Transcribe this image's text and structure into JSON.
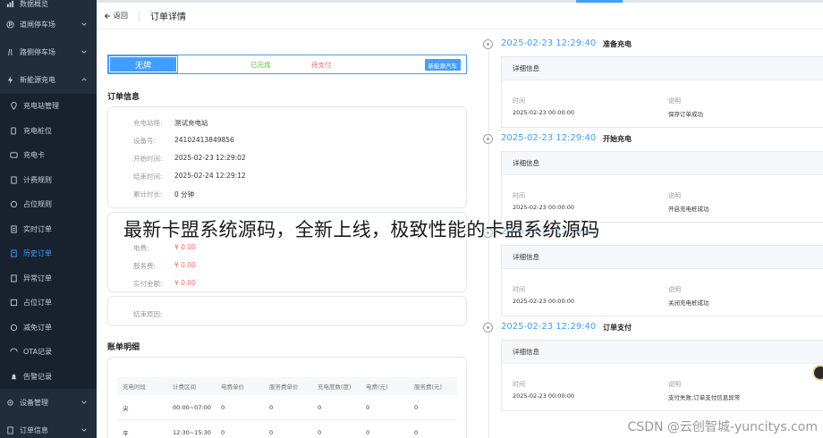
{
  "sidebar": {
    "items": [
      {
        "label": "数据概览",
        "icon": "chart-icon",
        "type": "top"
      },
      {
        "label": "道闸停车场",
        "icon": "parking-icon",
        "type": "group"
      },
      {
        "label": "路侧停车场",
        "icon": "road-icon",
        "type": "group"
      },
      {
        "label": "新能源充电",
        "icon": "charging-icon",
        "type": "group-open"
      },
      {
        "label": "充电站管理",
        "icon": "location-icon",
        "type": "sub"
      },
      {
        "label": "充电桩位",
        "icon": "pile-icon",
        "type": "sub"
      },
      {
        "label": "充电卡",
        "icon": "card-icon",
        "type": "sub"
      },
      {
        "label": "计费规则",
        "icon": "doc-icon",
        "type": "sub"
      },
      {
        "label": "占位规则",
        "icon": "rule-icon",
        "type": "sub"
      },
      {
        "label": "实时订单",
        "icon": "order-icon",
        "type": "sub"
      },
      {
        "label": "历史订单",
        "icon": "history-icon",
        "type": "sub-active"
      },
      {
        "label": "异常订单",
        "icon": "warning-order-icon",
        "type": "sub"
      },
      {
        "label": "占位订单",
        "icon": "occupy-icon",
        "type": "sub"
      },
      {
        "label": "减免订单",
        "icon": "discount-icon",
        "type": "sub"
      },
      {
        "label": "OTA记录",
        "icon": "ota-icon",
        "type": "sub"
      },
      {
        "label": "告警记录",
        "icon": "alarm-icon",
        "type": "sub"
      },
      {
        "label": "设备管理",
        "icon": "device-icon",
        "type": "group"
      },
      {
        "label": "订单信息",
        "icon": "info-icon",
        "type": "group"
      }
    ]
  },
  "header": {
    "back_label": "返回",
    "title": "订单详情"
  },
  "status": {
    "plate": "无牌",
    "completed": "已完成",
    "unpaid": "待支付",
    "new_car_button": "新能源汽车"
  },
  "order_info": {
    "title": "订单信息",
    "rows": [
      {
        "label": "充电站络:",
        "value": "测试充电站"
      },
      {
        "label": "设备号:",
        "value": "24102413849856"
      },
      {
        "label": "开始时间:",
        "value": "2025-02-23 12:29:02"
      },
      {
        "label": "结束时间:",
        "value": "2025-02-24 12:29:12"
      },
      {
        "label": "累计时长:",
        "value": "0 分钟"
      }
    ],
    "fee_rows": [
      {
        "label": "电费:",
        "value": "¥ 0.00"
      },
      {
        "label": "服务费:",
        "value": "¥ 0.00"
      },
      {
        "label": "实付金额:",
        "value": "¥ 0.00"
      }
    ],
    "end_reason_label": "结束原因:"
  },
  "bill": {
    "title": "账单明细",
    "headers": [
      "充电时段",
      "计费区间",
      "电费单价",
      "服务费单价",
      "充电度数(度)",
      "电费(元)",
      "服务费(元)"
    ],
    "rows": [
      [
        "尖",
        "00:00~07:00",
        "0",
        "0",
        "0",
        "0",
        "0"
      ],
      [
        "平",
        "12:30~15:30",
        "0",
        "0",
        "0",
        "0",
        "0"
      ]
    ]
  },
  "timeline": [
    {
      "time": "2025-02-23 12:29:40",
      "event": "准备充电",
      "card_title": "详细信息",
      "time_label": "时间",
      "desc_label": "说明",
      "time_value": "2025-02-23 00:00:00",
      "desc_value": "保存订单成功"
    },
    {
      "time": "2025-02-23 12:29:40",
      "event": "开始充电",
      "card_title": "详细信息",
      "time_label": "时间",
      "desc_label": "说明",
      "time_value": "2025-02-23 00:00:00",
      "desc_value": "开启充电桩成功"
    },
    {
      "time": "2025-02-23 12:29:40",
      "event": "",
      "card_title": "详细信息",
      "time_label": "时间",
      "desc_label": "说明",
      "time_value": "2025-02-23 00:00:00",
      "desc_value": "关闭充电桩成功"
    },
    {
      "time": "2025-02-23 12:29:40",
      "event": "订单支付",
      "card_title": "详细信息",
      "time_label": "时间",
      "desc_label": "说明",
      "time_value": "2025-02-23 00:00:00",
      "desc_value": "支付失败;订单支付信息异常"
    }
  ],
  "overlay": {
    "banner": "最新卡盟系统源码，全新上线，极致性能的卡盟系统源码",
    "watermark": "CSDN @云创智城-yuncitys.com"
  },
  "colors": {
    "accent": "#409eff",
    "sidebar": "#1f2d3d",
    "success": "#67c23a",
    "danger": "#f56c6c"
  }
}
